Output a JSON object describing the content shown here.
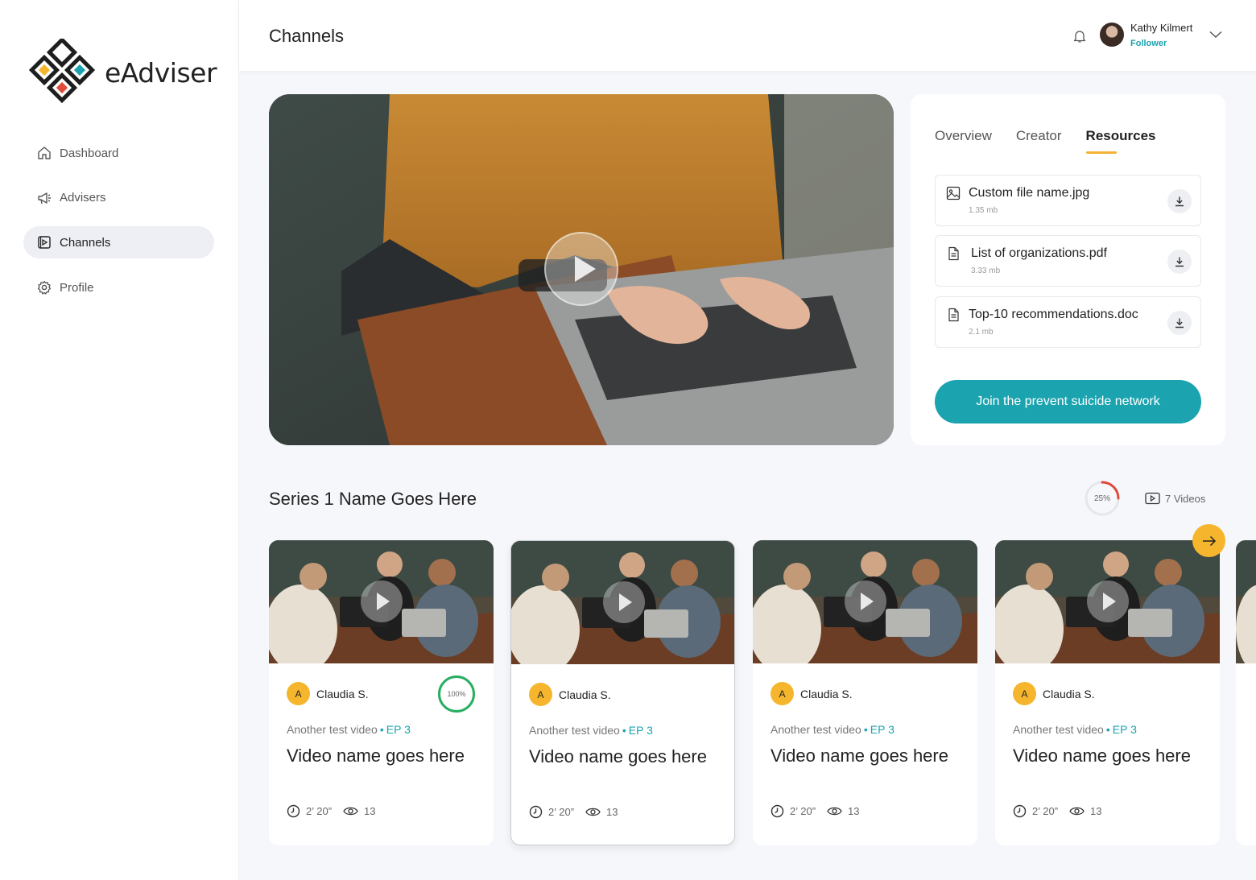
{
  "app": {
    "name": "eAdviser"
  },
  "sidebar": {
    "items": [
      {
        "label": "Dashboard",
        "icon": "home-icon"
      },
      {
        "label": "Advisers",
        "icon": "megaphone-icon"
      },
      {
        "label": "Channels",
        "icon": "video-icon",
        "active": true
      },
      {
        "label": "Profile",
        "icon": "gear-icon"
      }
    ]
  },
  "header": {
    "title": "Channels",
    "user": {
      "name": "Kathy Kilmert",
      "role": "Follower"
    }
  },
  "panel": {
    "tabs": [
      {
        "label": "Overview"
      },
      {
        "label": "Creator"
      },
      {
        "label": "Resources",
        "active": true
      }
    ],
    "resources": [
      {
        "name": "Custom file name.jpg",
        "size": "1.35 mb",
        "icon": "image-icon"
      },
      {
        "name": "List of organizations.pdf",
        "size": "3.33 mb",
        "icon": "document-icon"
      },
      {
        "name": "Top-10 recommendations.doc",
        "size": "2.1 mb",
        "icon": "document-icon"
      }
    ],
    "cta": "Join the prevent suicide network"
  },
  "series": {
    "title": "Series 1 Name Goes Here",
    "progress": "25%",
    "progress_value": 0.25,
    "videos": "7 Videos"
  },
  "cards": [
    {
      "initial": "A",
      "author": "Claudia S.",
      "progress": "100%",
      "subtitle": "Another test video",
      "episode": "EP 3",
      "title": "Video name goes here",
      "duration": "2’ 20”",
      "views": "13"
    },
    {
      "initial": "A",
      "author": "Claudia S.",
      "subtitle": "Another test video",
      "episode": "EP 3",
      "title": "Video name goes here",
      "duration": "2’ 20”",
      "views": "13"
    },
    {
      "initial": "A",
      "author": "Claudia S.",
      "subtitle": "Another test video",
      "episode": "EP 3",
      "title": "Video name goes here",
      "duration": "2’ 20”",
      "views": "13"
    },
    {
      "initial": "A",
      "author": "Claudia S.",
      "subtitle": "Another test video",
      "episode": "EP 3",
      "title": "Video name goes here",
      "duration": "2’ 20”",
      "views": "13"
    }
  ],
  "colors": {
    "accent": "#1ba3b0",
    "highlight": "#f5b62d",
    "complete": "#27ae60",
    "progress": "#e04a3a"
  }
}
